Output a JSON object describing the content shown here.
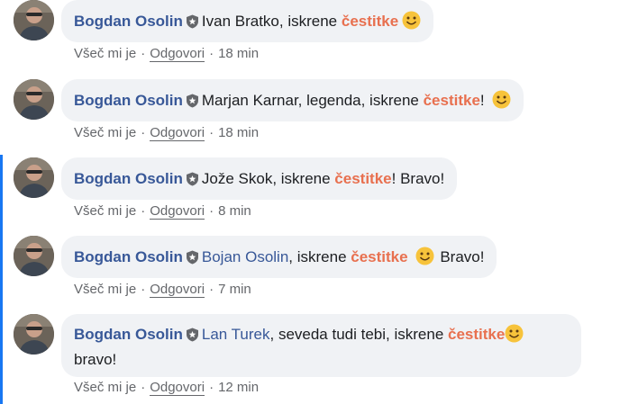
{
  "comments": [
    {
      "author": "Bogdan Osolin",
      "parts": [
        "Ivan Bratko, iskrene ",
        "čestitke",
        ""
      ],
      "mention": "",
      "like_label": "Všeč mi je",
      "reply_label": "Odgovori",
      "time": "18 min"
    },
    {
      "author": "Bogdan Osolin",
      "parts": [
        "Marjan Karnar, legenda, iskrene ",
        "čestitke",
        "! "
      ],
      "mention": "",
      "like_label": "Všeč mi je",
      "reply_label": "Odgovori",
      "time": "18 min"
    },
    {
      "author": "Bogdan Osolin",
      "parts": [
        "Jože Skok, iskrene ",
        "čestitke",
        "! Bravo!"
      ],
      "mention": "",
      "like_label": "Všeč mi je",
      "reply_label": "Odgovori",
      "time": "8 min"
    },
    {
      "author": "Bogdan Osolin",
      "mention": "Bojan Osolin",
      "parts": [
        ", iskrene ",
        "čestitke",
        " ",
        "Bravo!"
      ],
      "like_label": "Všeč mi je",
      "reply_label": "Odgovori",
      "time": "7 min"
    },
    {
      "author": "Bogdan Osolin",
      "mention": "Lan Turek",
      "parts": [
        ", seveda tudi tebi, iskrene ",
        "čestitke",
        "bravo!"
      ],
      "like_label": "Všeč mi je",
      "reply_label": "Odgovori",
      "time": "12 min"
    }
  ],
  "separator": "·",
  "colors": {
    "author": "#385898",
    "highlight": "#e8704f",
    "bubble": "#f0f2f5",
    "meta": "#65676b",
    "rail": "#1877f2"
  },
  "icons": {
    "badge": "shield-star-icon",
    "emoji": "smiley-emoji-icon"
  }
}
